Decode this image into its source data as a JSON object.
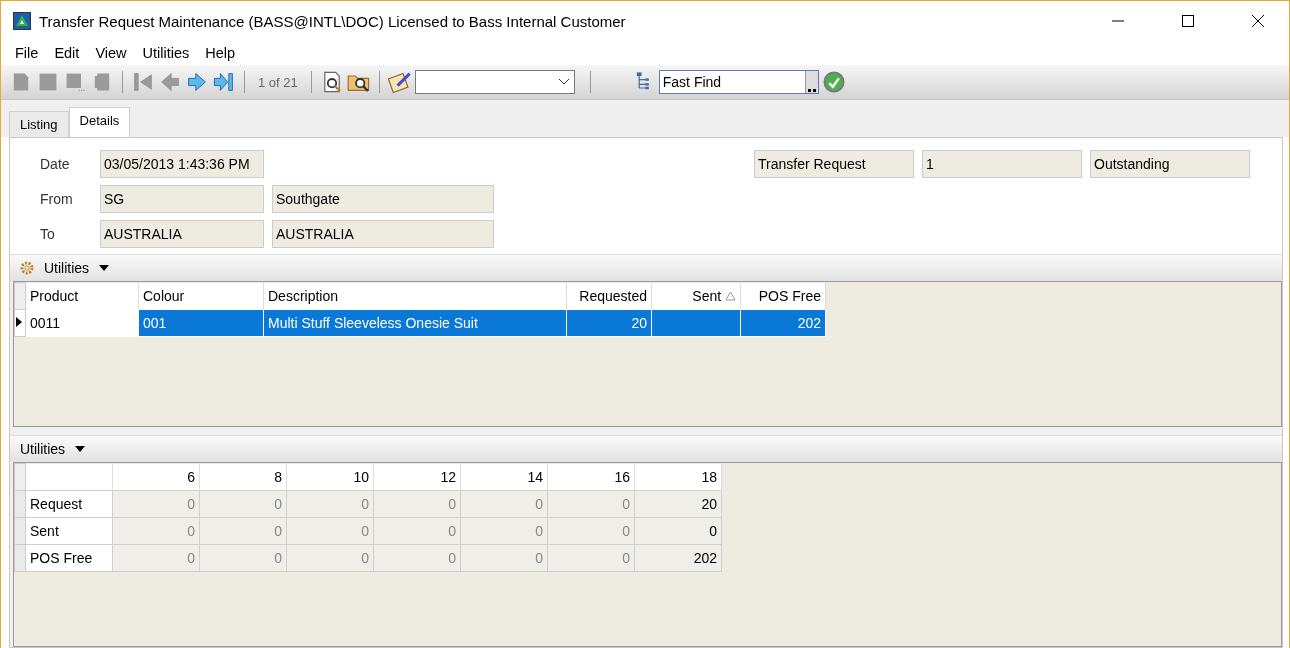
{
  "window": {
    "title": "Transfer Request Maintenance (BASS@INTL\\DOC) Licensed to Bass Internal Customer"
  },
  "menu": [
    "File",
    "Edit",
    "View",
    "Utilities",
    "Help"
  ],
  "toolbar": {
    "record_buttons": [
      {
        "kind": "new",
        "disabled": true
      },
      {
        "kind": "save",
        "disabled": true
      },
      {
        "kind": "more",
        "disabled": true
      },
      {
        "kind": "delete",
        "disabled": true
      }
    ],
    "nav_buttons": [
      {
        "kind": "first",
        "disabled": true
      },
      {
        "kind": "prev",
        "disabled": true
      },
      {
        "kind": "next",
        "disabled": false
      },
      {
        "kind": "last",
        "disabled": false
      }
    ],
    "position": "1 of 21",
    "fast_find": "Fast Find"
  },
  "tabs": [
    {
      "label": "Listing",
      "selected": false
    },
    {
      "label": "Details",
      "selected": true
    }
  ],
  "header": {
    "date_label": "Date",
    "date": "03/05/2013 1:43:36 PM",
    "from_label": "From",
    "from_code": "SG",
    "from_name": "Southgate",
    "to_label": "To",
    "to_code": "AUSTRALIA",
    "to_name": "AUSTRALIA",
    "type": "Transfer Request",
    "number": "1",
    "status": "Outstanding"
  },
  "lines": {
    "utilities": "Utilities",
    "columns": [
      {
        "label": "Product"
      },
      {
        "label": "Colour"
      },
      {
        "label": "Description"
      },
      {
        "label": "Requested"
      },
      {
        "label": "Sent",
        "sorted": true
      },
      {
        "label": "POS Free"
      }
    ],
    "rows": [
      {
        "selected": true,
        "cells": [
          "0011",
          "001",
          "Multi Stuff Sleeveless Onesie Suit",
          "20",
          "",
          "202"
        ]
      }
    ]
  },
  "sizes": {
    "utilities": "Utilities",
    "columns": [
      {
        "label": "6",
        "disabled": true
      },
      {
        "label": "8",
        "disabled": true
      },
      {
        "label": "10",
        "disabled": true
      },
      {
        "label": "12",
        "disabled": true
      },
      {
        "label": "14",
        "disabled": true
      },
      {
        "label": "16",
        "disabled": true
      },
      {
        "label": "18",
        "disabled": false
      }
    ],
    "rows": [
      {
        "label": "Request",
        "cells": [
          "0",
          "0",
          "0",
          "0",
          "0",
          "0",
          "20"
        ]
      },
      {
        "label": "Sent",
        "cells": [
          "0",
          "0",
          "0",
          "0",
          "0",
          "0",
          "0"
        ]
      },
      {
        "label": "POS Free",
        "cells": [
          "0",
          "0",
          "0",
          "0",
          "0",
          "0",
          "202"
        ]
      }
    ]
  }
}
